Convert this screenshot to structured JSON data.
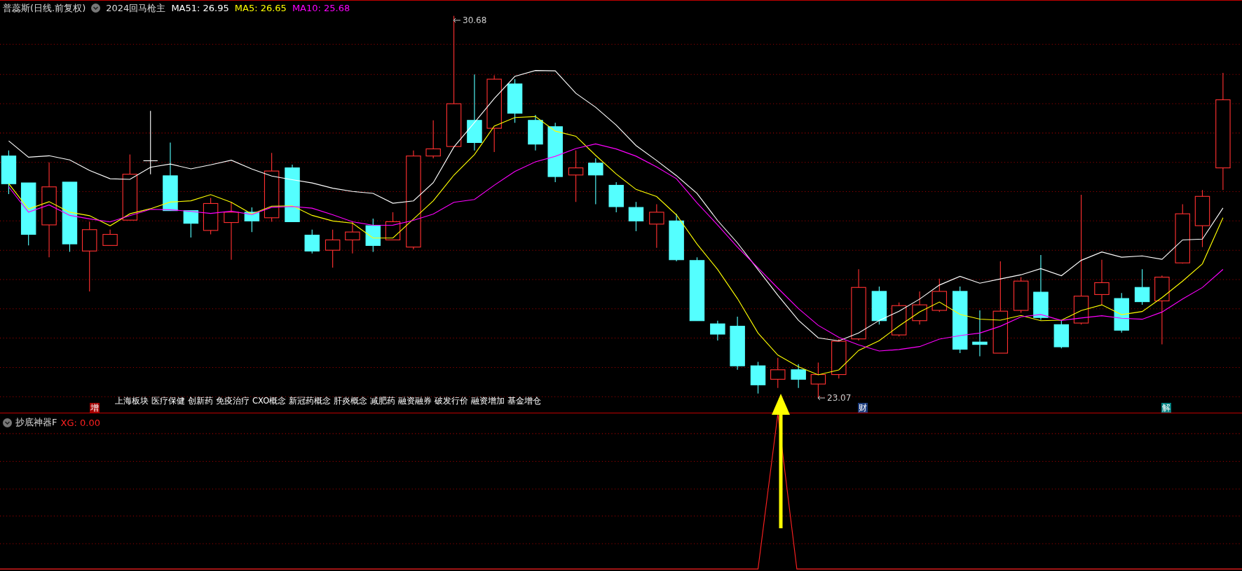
{
  "title_bar": {
    "stock": "普蕊斯(日线.前复权)",
    "indicator": "2024回马枪主",
    "values": [
      {
        "label": "MA51: 26.95",
        "color": "#ffffff"
      },
      {
        "label": "MA5: 26.65",
        "color": "#ffff00"
      },
      {
        "label": "MA10: 25.68",
        "color": "#ff00ff"
      }
    ]
  },
  "main_chart": {
    "high_label": "30.68",
    "low_label": "23.07",
    "tags": [
      "上海板块",
      "医疗保健",
      "创新药",
      "免疫治疗",
      "CXO概念",
      "新冠药概念",
      "肝炎概念",
      "减肥药",
      "融资融券",
      "破发行价",
      "融资增加",
      "基金增仓"
    ],
    "markers": [
      {
        "label": "增",
        "color": "#a00000"
      },
      {
        "label": "财",
        "color": "#1a3a7a"
      },
      {
        "label": "解",
        "color": "#008080"
      }
    ]
  },
  "sub_chart": {
    "name": "抄底神器F",
    "reading": "XG: 0.00"
  }
}
